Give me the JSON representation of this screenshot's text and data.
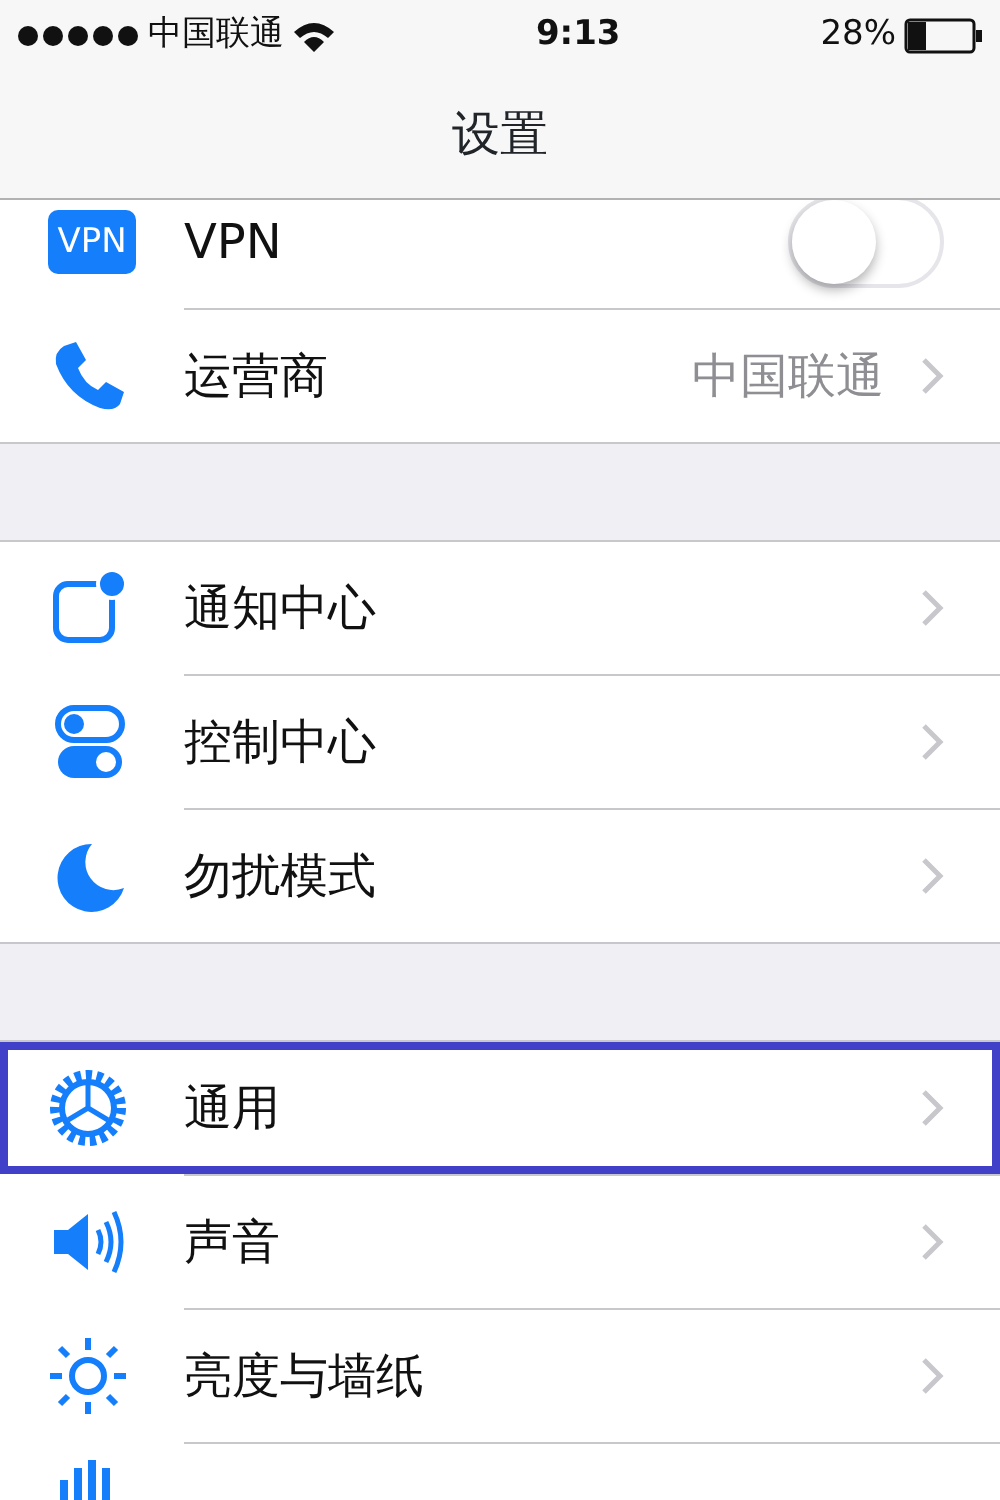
{
  "status_bar": {
    "carrier": "中国联通",
    "time": "9:13",
    "battery": "28%"
  },
  "nav_bar": {
    "title": "设置"
  },
  "groups": [
    {
      "rows": [
        {
          "kind": "toggle",
          "badge": "VPN",
          "label": "VPN",
          "on": false
        },
        {
          "kind": "link",
          "label": "运营商",
          "value": "中国联通",
          "highlighted": false
        }
      ]
    },
    {
      "rows": [
        {
          "kind": "link",
          "label": "通知中心",
          "highlighted": false
        },
        {
          "kind": "link",
          "label": "控制中心",
          "highlighted": false
        },
        {
          "kind": "link",
          "label": "勿扰模式",
          "highlighted": false
        }
      ]
    },
    {
      "rows": [
        {
          "kind": "link",
          "label": "通用",
          "highlighted": true
        },
        {
          "kind": "link",
          "label": "声音",
          "highlighted": false
        },
        {
          "kind": "link",
          "label": "亮度与墙纸",
          "highlighted": false
        },
        {
          "kind": "stub"
        }
      ]
    }
  ]
}
